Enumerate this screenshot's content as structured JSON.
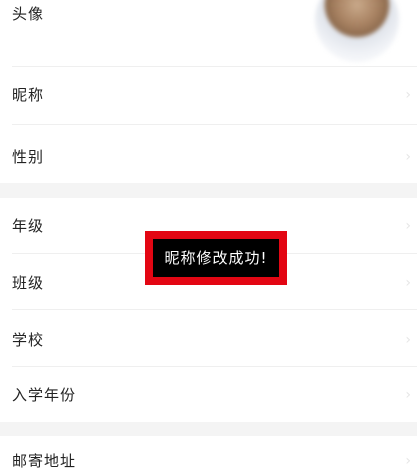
{
  "profile": {
    "avatar": {
      "label": "头像"
    },
    "nickname": {
      "label": "昵称"
    },
    "gender": {
      "label": "性别"
    }
  },
  "school_info": {
    "grade": {
      "label": "年级"
    },
    "class": {
      "label": "班级"
    },
    "school": {
      "label": "学校"
    },
    "enrollment_year": {
      "label": "入学年份"
    }
  },
  "contact": {
    "mailing_address": {
      "label": "邮寄地址"
    }
  },
  "toast": {
    "message": "昵称修改成功!"
  },
  "colors": {
    "toast_background": "#000000",
    "toast_text": "#ffffff",
    "highlight_border": "#e30613",
    "section_gap": "#f4f4f4"
  }
}
